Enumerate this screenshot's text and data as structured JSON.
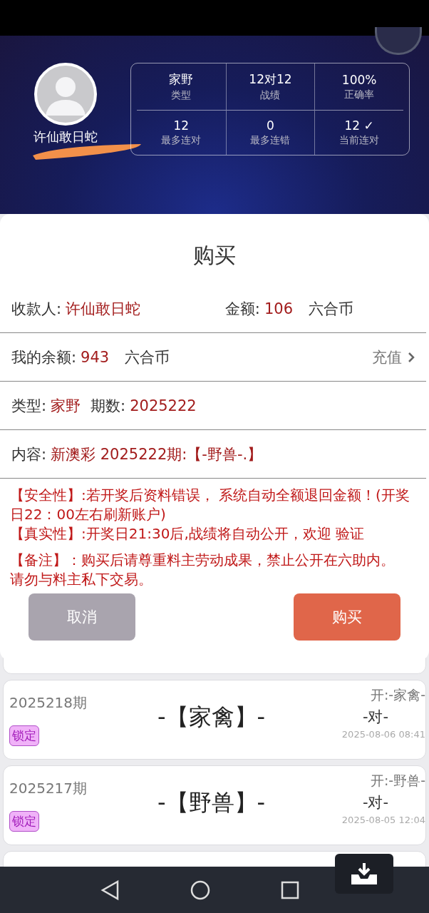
{
  "profile": {
    "name": "许仙敢日蛇",
    "stats": [
      {
        "value": "家野",
        "label": "类型"
      },
      {
        "value": "12对12",
        "label": "战绩"
      },
      {
        "value": "100%",
        "label": "正确率"
      },
      {
        "value": "12",
        "label": "最多连对"
      },
      {
        "value": "0",
        "label": "最多连错"
      },
      {
        "value": "12 ✓",
        "label": "当前连对"
      }
    ]
  },
  "dialog": {
    "title": "购买",
    "payee": {
      "label": "收款人:",
      "value": "许仙敢日蛇"
    },
    "amount": {
      "label": "金额:",
      "value": "106",
      "unit": "六合币"
    },
    "balance": {
      "label": "我的余额:",
      "value": "943",
      "unit": "六合币"
    },
    "recharge": "充值",
    "type": {
      "label": "类型:",
      "value": "家野"
    },
    "period": {
      "label": "期数:",
      "value": "2025222"
    },
    "content": {
      "label": "内容:",
      "value": "新澳彩 2025222期:【-野兽-.】"
    },
    "notes": [
      "【安全性】:若开奖后资料错误， 系统自动全额退回金额！(开奖日22：00左右刷新账户)",
      "【真实性】:开奖日21:30后,战绩将自动公开，欢迎 验证",
      "【备注】：购买后请尊重料主劳动成果，禁止公开在六助内。",
      "请勿与料主私下交易。"
    ],
    "buttons": [
      {
        "label": "取消",
        "kind": "cancel"
      },
      {
        "label": "购买",
        "kind": "confirm"
      }
    ]
  },
  "records": [
    {
      "period": "2025218期",
      "badge": "锁定",
      "pick": "-【家禽】-",
      "result": "开:-家禽-",
      "verdict": "-对-",
      "time": "2025-08-06 08:41"
    },
    {
      "period": "2025217期",
      "badge": "锁定",
      "pick": "-【野兽】-",
      "result": "开:-野兽-",
      "verdict": "-对-",
      "time": "2025-08-05 12:04"
    }
  ]
}
